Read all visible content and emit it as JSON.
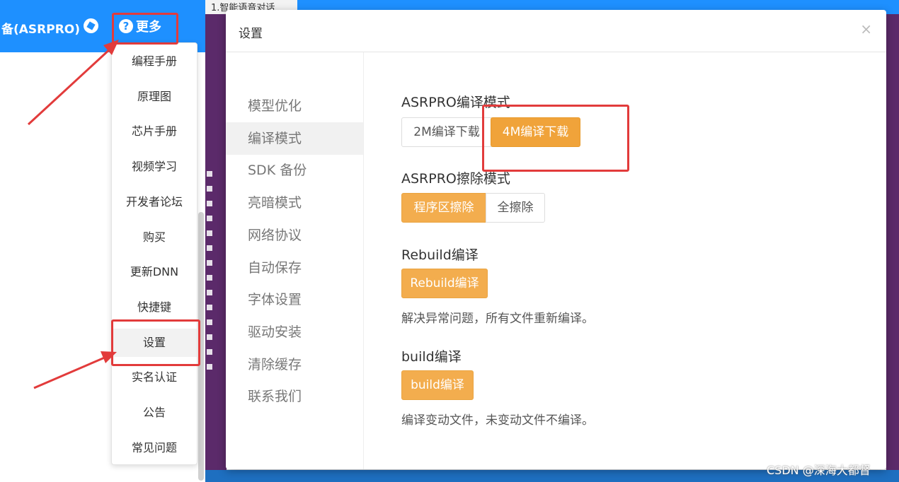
{
  "app": {
    "title": "备(ASRPRO)",
    "more_label": "更多",
    "help_glyph": "?"
  },
  "background": {
    "tab_label": "1.智能语音对话"
  },
  "more_menu": {
    "items": [
      {
        "label": "编程手册"
      },
      {
        "label": "原理图"
      },
      {
        "label": "芯片手册"
      },
      {
        "label": "视频学习"
      },
      {
        "label": "开发者论坛"
      },
      {
        "label": "购买"
      },
      {
        "label": "更新DNN"
      },
      {
        "label": "快捷键"
      },
      {
        "label": "设置",
        "active": true
      },
      {
        "label": "实名认证"
      },
      {
        "label": "公告"
      },
      {
        "label": "常见问题"
      }
    ]
  },
  "dialog": {
    "title": "设置",
    "close_glyph": "×",
    "nav": [
      {
        "label": "模型优化"
      },
      {
        "label": "编译模式",
        "active": true
      },
      {
        "label": "SDK 备份"
      },
      {
        "label": "亮暗模式"
      },
      {
        "label": "网络协议"
      },
      {
        "label": "自动保存"
      },
      {
        "label": "字体设置"
      },
      {
        "label": "驱动安装"
      },
      {
        "label": "清除缓存"
      },
      {
        "label": "联系我们"
      }
    ],
    "compile_mode": {
      "heading": "ASRPRO编译模式",
      "option_2m": "2M编译下载",
      "option_4m": "4M编译下载",
      "selected": "4M编译下载"
    },
    "erase_mode": {
      "heading": "ASRPRO擦除模式",
      "option_program": "程序区擦除",
      "option_full": "全擦除",
      "selected": "程序区擦除"
    },
    "rebuild": {
      "heading": "Rebuild编译",
      "button": "Rebuild编译",
      "desc": "解决异常问题，所有文件重新编译。"
    },
    "build": {
      "heading": "build编译",
      "button": "build编译",
      "desc": "编译变动文件，未变动文件不编译。"
    }
  },
  "watermark": "CSDN @深海大都督",
  "colors": {
    "brand_blue": "#1e90ff",
    "accent_orange": "#f0a33a",
    "annotation_red": "#e23b3b"
  }
}
